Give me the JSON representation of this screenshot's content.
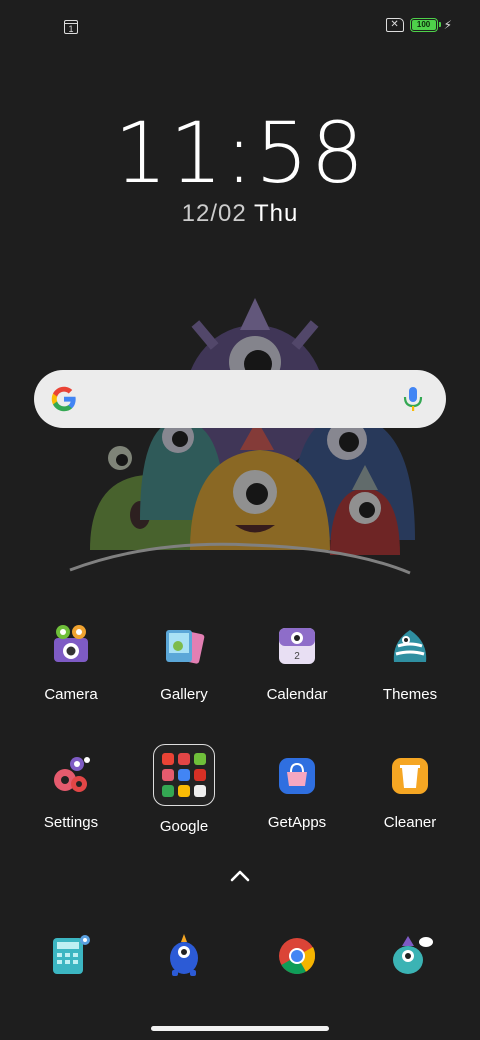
{
  "status_bar": {
    "notification_icon": "calendar-notification-icon",
    "notification_day": "1",
    "sim_icon": "no-sim-icon",
    "battery_level": "100",
    "battery_color": "#4ed14a",
    "charging_icon": "bolt-icon"
  },
  "lockclock": {
    "time": "11:58",
    "date_num": "12/02",
    "date_day": "Thu"
  },
  "search_widget": {
    "logo_icon": "google-g-icon",
    "mic_icon": "microphone-icon"
  },
  "apps_row1": [
    {
      "label": "Camera",
      "icon": "camera-icon"
    },
    {
      "label": "Gallery",
      "icon": "gallery-icon"
    },
    {
      "label": "Calendar",
      "icon": "calendar-icon",
      "badge": "2"
    },
    {
      "label": "Themes",
      "icon": "themes-icon"
    }
  ],
  "apps_row2": [
    {
      "label": "Settings",
      "icon": "settings-icon"
    },
    {
      "label": "Google",
      "icon": "folder-icon"
    },
    {
      "label": "GetApps",
      "icon": "getapps-icon"
    },
    {
      "label": "Cleaner",
      "icon": "cleaner-icon"
    }
  ],
  "dock": [
    {
      "icon": "calculator-icon"
    },
    {
      "icon": "monster-contacts-icon"
    },
    {
      "icon": "chrome-icon"
    },
    {
      "icon": "monster-messages-icon"
    }
  ],
  "app_drawer_icon": "chevron-up-icon",
  "colors": {
    "background": "#1e1e1e",
    "search_bg": "#ececec",
    "google_blue": "#4285f4",
    "google_red": "#ea4335",
    "google_yellow": "#fbbc05",
    "google_green": "#34a853"
  }
}
